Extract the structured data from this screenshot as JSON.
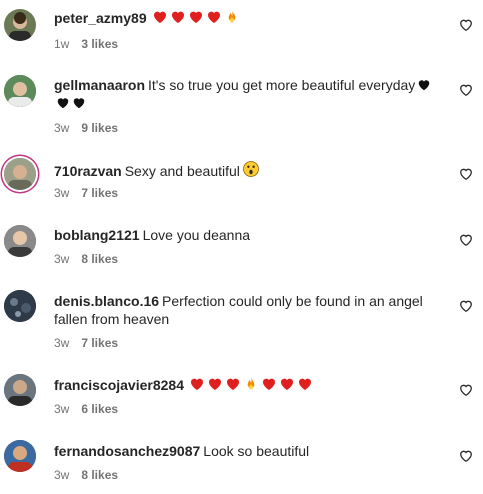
{
  "comments": [
    {
      "username": "peter_azmy89",
      "text": "",
      "emojis": [
        "red-heart",
        "red-heart",
        "red-heart",
        "red-heart",
        "fire"
      ],
      "time": "1w",
      "likes": "3 likes",
      "avatar_color": "#6b7a55"
    },
    {
      "username": "gellmanaaron",
      "text": "It's so true you get more beautiful everyday",
      "emojis": [
        "black-heart",
        "black-heart",
        "black-heart"
      ],
      "time": "3w",
      "likes": "9 likes",
      "avatar_color": "#2f6b3a"
    },
    {
      "username": "710razvan",
      "text": "Sexy and beautiful",
      "emojis": [
        "astonished-face"
      ],
      "time": "3w",
      "likes": "7 likes",
      "avatar_color": "#8c8c7a"
    },
    {
      "username": "boblang2121",
      "text": "Love you deanna",
      "emojis": [],
      "time": "3w",
      "likes": "8 likes",
      "avatar_color": "#5a5a5a"
    },
    {
      "username": "denis.blanco.16",
      "text": "Perfection could only be found in an angel fallen from heaven",
      "emojis": [],
      "time": "3w",
      "likes": "7 likes",
      "avatar_color": "#3a4a5a"
    },
    {
      "username": "franciscojavier8284",
      "text": "",
      "emojis": [
        "red-heart",
        "red-heart",
        "red-heart",
        "fire",
        "red-heart",
        "red-heart",
        "red-heart"
      ],
      "time": "3w",
      "likes": "6 likes",
      "avatar_color": "#4a5560"
    },
    {
      "username": "fernandosanchez9087",
      "text": "Look so beautiful",
      "emojis": [],
      "time": "3w",
      "likes": "8 likes",
      "avatar_color": "#2d4a6a"
    }
  ],
  "colors": {
    "red_heart": "#e0201f",
    "fire": "#f28b00",
    "meta_gray": "#737373",
    "text": "#262626"
  }
}
